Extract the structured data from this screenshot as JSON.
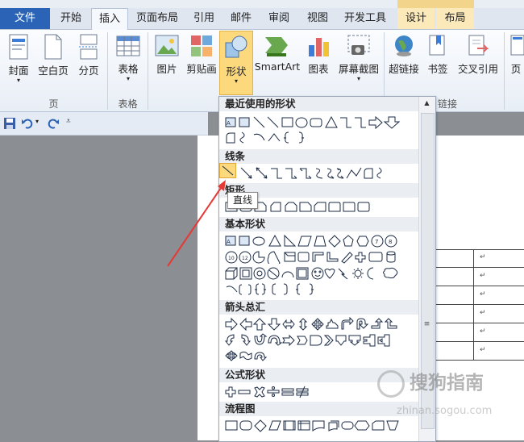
{
  "tabs": {
    "file": "文件",
    "home": "开始",
    "insert": "插入",
    "layout": "页面布局",
    "references": "引用",
    "mailings": "邮件",
    "review": "审阅",
    "view": "视图",
    "developer": "开发工具",
    "design": "设计",
    "table_layout": "布局"
  },
  "ribbon": {
    "cover": "封面",
    "blank": "空白页",
    "break": "分页",
    "table": "表格",
    "picture": "图片",
    "clipart": "剪贴画",
    "shapes": "形状",
    "smartart": "SmartArt",
    "chart": "图表",
    "screenshot": "屏幕截图",
    "hyperlink": "超链接",
    "bookmark": "书签",
    "crossref": "交叉引用",
    "header_partial": "页",
    "group_pages": "页",
    "group_tables": "表格",
    "group_links_partial": "链接"
  },
  "dropdown": {
    "recent": "最近使用的形状",
    "lines": "线条",
    "rect_partial": "矩形",
    "basic": "基本形状",
    "arrows": "箭头总汇",
    "equation": "公式形状",
    "flowchart": "流程图"
  },
  "tooltip": "直线",
  "watermark": {
    "main": "搜狗指南",
    "sub": "zhinan.sogou.com"
  },
  "colors": {
    "accent": "#2b63b6",
    "highlight": "#fbd97c",
    "arrow": "#e53935"
  }
}
